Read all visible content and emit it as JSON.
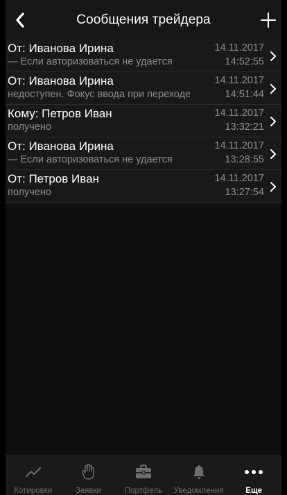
{
  "header": {
    "title": "Сообщения трейдера",
    "back_icon": "chevron-left-icon",
    "add_icon": "plus-icon"
  },
  "messages": [
    {
      "title": "От: Иванова Ирина",
      "preview": "—   Если авторизоваться не удается",
      "date": "14.11.2017",
      "time": "14:52:55"
    },
    {
      "title": "От: Иванова Ирина",
      "preview": "недоступен. Фокус ввода при переходе",
      "date": "14.11.2017",
      "time": "14:51:44"
    },
    {
      "title": "Кому: Петров Иван",
      "preview": "получено",
      "date": "14.11.2017",
      "time": "13:32:21"
    },
    {
      "title": "От: Иванова Ирина",
      "preview": "—   Если авторизоваться не удается",
      "date": "14.11.2017",
      "time": "13:28:55"
    },
    {
      "title": "От: Петров Иван",
      "preview": "получено",
      "date": "14.11.2017",
      "time": "13:27:54"
    }
  ],
  "tabs": [
    {
      "label": "Котировки",
      "icon": "chart-line-icon"
    },
    {
      "label": "Заявки",
      "icon": "hand-icon"
    },
    {
      "label": "Портфель",
      "icon": "briefcase-icon"
    },
    {
      "label": "Уведомления",
      "icon": "bell-icon"
    },
    {
      "label": "Еще",
      "icon": "more-dots-icon"
    }
  ],
  "colors": {
    "background": "#0f0f0f",
    "row_background": "#191919",
    "secondary_text": "#8e8e8e",
    "tab_inactive": "#6d6d6d",
    "tab_active": "#ffffff"
  }
}
